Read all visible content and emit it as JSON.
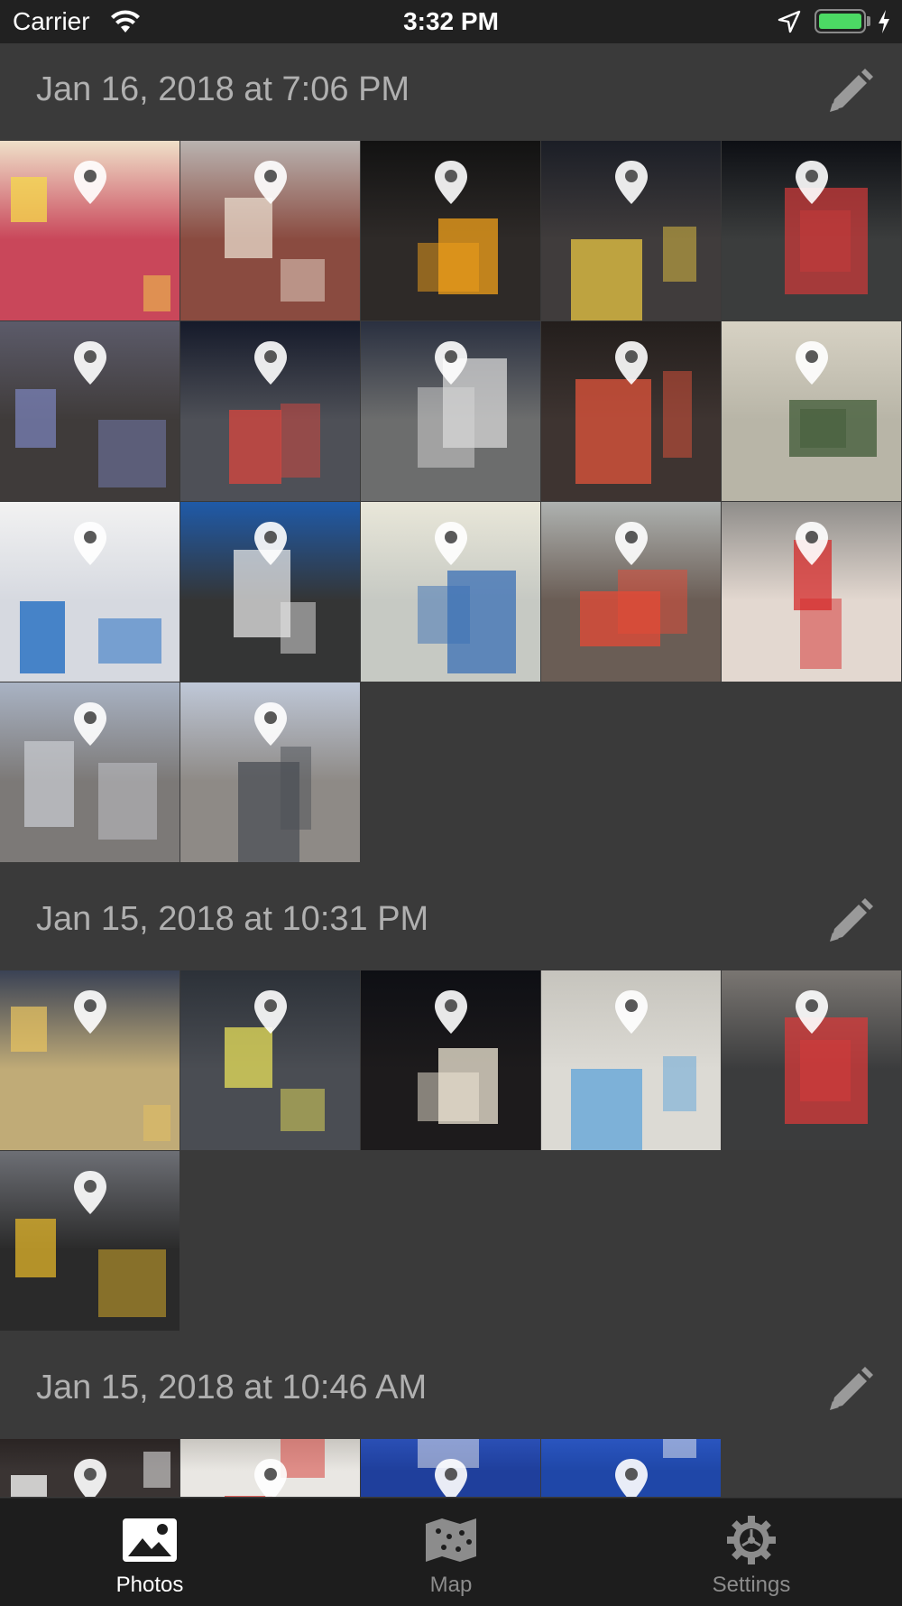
{
  "status_bar": {
    "carrier": "Carrier",
    "time": "3:32 PM",
    "battery_level": 1.0
  },
  "sections": [
    {
      "title": "Jan 16, 2018 at 7:06 PM",
      "photos": [
        {
          "bg": "#c9475a",
          "accent": "#f5d94a",
          "sky": "#efe0c9"
        },
        {
          "bg": "#8a4b40",
          "accent": "#e9dccd",
          "sky": "#b9b3b0"
        },
        {
          "bg": "#2e2a28",
          "accent": "#f3a21a",
          "sky": "#121212"
        },
        {
          "bg": "#403c3c",
          "accent": "#e8c542",
          "sky": "#1b1e26"
        },
        {
          "bg": "#3b3d3d",
          "accent": "#c93a3a",
          "sky": "#0d0f14"
        },
        {
          "bg": "#3f3b3a",
          "accent": "#7a82b8",
          "sky": "#5c5b6a"
        },
        {
          "bg": "#4e5057",
          "accent": "#d9453d",
          "sky": "#151a2a"
        },
        {
          "bg": "#6c6d6d",
          "accent": "#d7d7d7",
          "sky": "#2a3040"
        },
        {
          "bg": "#3e3431",
          "accent": "#e2543b",
          "sky": "#231e1c"
        },
        {
          "bg": "#b8b5a7",
          "accent": "#3f5a36",
          "sky": "#d7d2c4"
        },
        {
          "bg": "#d6d9e0",
          "accent": "#1565c0",
          "sky": "#f2f2f2"
        },
        {
          "bg": "#343535",
          "accent": "#e5e5e5",
          "sky": "#1f5aa8"
        },
        {
          "bg": "#c6c9c3",
          "accent": "#3a6fb5",
          "sky": "#e9e7d9"
        },
        {
          "bg": "#6a5d55",
          "accent": "#e54a36",
          "sky": "#aeb2b0"
        },
        {
          "bg": "#e3d8d0",
          "accent": "#d52b2b",
          "sky": "#8f8d8a"
        },
        {
          "bg": "#7c7977",
          "accent": "#c7c9cf",
          "sky": "#a9b3c4"
        },
        {
          "bg": "#8e8a86",
          "accent": "#4b4f55",
          "sky": "#bfc8d8"
        }
      ]
    },
    {
      "title": "Jan 15, 2018 at 10:31 PM",
      "photos": [
        {
          "bg": "#c0ab77",
          "accent": "#e5c160",
          "sky": "#3a4255"
        },
        {
          "bg": "#4a4d53",
          "accent": "#e8e05a",
          "sky": "#2c3138"
        },
        {
          "bg": "#1d1b1c",
          "accent": "#f1ead7",
          "sky": "#0e0f14"
        },
        {
          "bg": "#dcdad4",
          "accent": "#5da3d9",
          "sky": "#c6c4bd"
        },
        {
          "bg": "#3b3c3d",
          "accent": "#d83a3a",
          "sky": "#7a7672"
        },
        {
          "bg": "#2a2a2a",
          "accent": "#e3b62a",
          "sky": "#6d6f75"
        }
      ]
    },
    {
      "title": "Jan 15, 2018 at 10:46 AM",
      "photos": [
        {
          "bg": "#3a3433",
          "accent": "#ffffff",
          "sky": "#2a2423"
        },
        {
          "bg": "#e9e7e3",
          "accent": "#d6342e",
          "sky": "#c9c6c0"
        },
        {
          "bg": "#1f3f9c",
          "accent": "#f1f1f1",
          "sky": "#2a4fb5"
        },
        {
          "bg": "#1f47a8",
          "accent": "#f1f1f1",
          "sky": "#2a55bf"
        }
      ]
    }
  ],
  "tab_bar": {
    "tabs": [
      {
        "label": "Photos",
        "icon": "photos-icon",
        "selected": true
      },
      {
        "label": "Map",
        "icon": "map-icon",
        "selected": false
      },
      {
        "label": "Settings",
        "icon": "gear-icon",
        "selected": false
      }
    ]
  },
  "colors": {
    "background": "#3a3a3a",
    "section_title": "#b0b0b0",
    "tab_selected": "#ffffff",
    "tab_unselected": "#8c8c8c",
    "battery": "#4cd964"
  }
}
